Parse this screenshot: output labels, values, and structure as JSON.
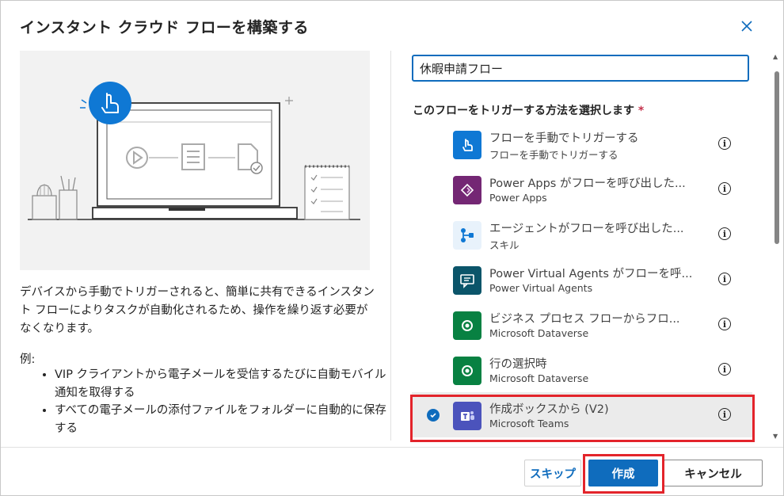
{
  "dialog": {
    "title": "インスタント クラウド フローを構築する",
    "close_icon": "close-icon"
  },
  "left": {
    "description": "デバイスから手動でトリガーされると、簡単に共有できるインスタント フローによりタスクが自動化されるため、操作を繰り返す必要がなくなります。",
    "example_label": "例:",
    "examples": [
      "VIP クライアントから電子メールを受信するたびに自動モバイル通知を取得する",
      "すべての電子メールの添付ファイルをフォルダーに自動的に保存する"
    ]
  },
  "form": {
    "flow_name_value": "休暇申請フロー",
    "trigger_label": "このフローをトリガーする方法を選択します",
    "required_mark": "*"
  },
  "triggers": [
    {
      "name": "フローを手動でトリガーする",
      "sub": "フローを手動でトリガーする",
      "icon": "hand-pointer-icon",
      "color": "#0f78d4",
      "selected": false
    },
    {
      "name": "Power Apps がフローを呼び出した...",
      "sub": "Power Apps",
      "icon": "power-apps-icon",
      "color": "#742774",
      "selected": false
    },
    {
      "name": "エージェントがフローを呼び出した...",
      "sub": "スキル",
      "icon": "agent-skill-icon",
      "color": "#e8f2fb",
      "selected": false
    },
    {
      "name": "Power Virtual Agents がフローを呼...",
      "sub": "Power Virtual Agents",
      "icon": "power-virtual-agents-icon",
      "color": "#0b556a",
      "selected": false
    },
    {
      "name": "ビジネス プロセス フローからフロ...",
      "sub": "Microsoft Dataverse",
      "icon": "dataverse-icon",
      "color": "#088142",
      "selected": false
    },
    {
      "name": "行の選択時",
      "sub": "Microsoft Dataverse",
      "icon": "dataverse-icon",
      "color": "#088142",
      "selected": false
    },
    {
      "name": "作成ボックスから (V2)",
      "sub": "Microsoft Teams",
      "icon": "teams-icon",
      "color": "#4b53bc",
      "selected": true
    }
  ],
  "buttons": {
    "skip": "スキップ",
    "create": "作成",
    "cancel": "キャンセル"
  },
  "colors": {
    "accent": "#0f6cbd",
    "highlight": "#e3242b"
  }
}
